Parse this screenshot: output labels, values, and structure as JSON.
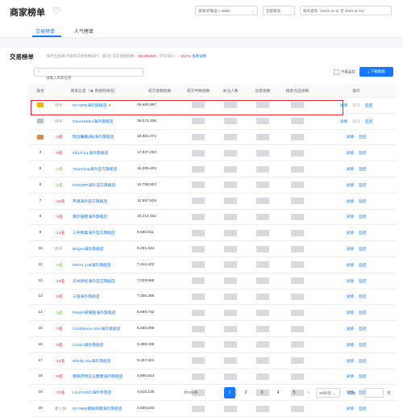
{
  "header": {
    "title": "商家榜单",
    "filter_industry": "美妆/护肤品 > NMN",
    "filter_channel": "全部渠道",
    "filter_date": "按天查询（2024-11-11 至 2024-11-11）"
  },
  "tabs": [
    {
      "label": "交易榜单"
    },
    {
      "label": "人气榜单"
    }
  ],
  "section": {
    "title": "交易榜单",
    "desc_prefix": "按行业类目/子类目交易指数排行，第1名 成交金额指数：",
    "desc_value": "49,680,967",
    "desc_mid": "，环比增长：",
    "desc_growth": "↑ 10.2%",
    "desc_link": "查看详情"
  },
  "search": {
    "placeholder": "请输入商家名称"
  },
  "only_watched": "只看监控",
  "download_label": "下载数据",
  "columns": [
    "排名",
    "商家信息（★ 则规则排名）",
    "成交金额指数",
    "成交件数指数",
    "关注人数",
    "访客指数",
    "搜索点击指数",
    "操作"
  ],
  "rows": [
    {
      "rank": "1",
      "change": "持平",
      "dir": "flat",
      "shop": "W+NMN海外旗舰店",
      "sales": "49,680,967",
      "medal": "gold",
      "star": true
    },
    {
      "rank": "2",
      "change": "持平",
      "dir": "flat",
      "shop": "GeneHarbor海外旗舰店",
      "sales": "36,071,306",
      "medal": "silver"
    },
    {
      "rank": "3",
      "change": "↑3名",
      "dir": "up",
      "shop": "明治醫藥(株)海外旗舰店",
      "sales": "18,861,072",
      "medal": "bronze"
    },
    {
      "rank": "4",
      "change": "↑8名",
      "dir": "up",
      "shop": "CELFLLL海外旗舰店",
      "sales": "17,937,253"
    },
    {
      "rank": "5",
      "change": "↓1名",
      "dir": "down",
      "shop": "TimeShop海外官方旗舰店",
      "sales": "16,205,203"
    },
    {
      "rank": "6",
      "change": "↓1名",
      "dir": "down",
      "shop": "PSSOPP海外官方旗舰店",
      "sales": "10,758,524"
    },
    {
      "rank": "7",
      "change": "↑23名",
      "dir": "up",
      "shop": "燕语海外官方旗舰店",
      "sales": "10,557,529"
    },
    {
      "rank": "8",
      "change": "↑3名",
      "dir": "up",
      "shop": "莱印维健海外旗舰店",
      "sales": "10,214,451"
    },
    {
      "rank": "9",
      "change": "↑14名",
      "dir": "up",
      "shop": "三井製菓海外官方旗舰店",
      "sales": "9,580,611"
    },
    {
      "rank": "10",
      "change": "持平",
      "dir": "flat",
      "shop": "Bioges海外旗舰店",
      "sales": "9,261,543"
    },
    {
      "rank": "11",
      "change": "↓3名",
      "dir": "down",
      "shop": "MIRAI LAB海外旗舰店",
      "sales": "7,244,422"
    },
    {
      "rank": "12",
      "change": "↑19名",
      "dir": "up",
      "shop": "日本新松海外官方旗舰店",
      "sales": "7,028,896"
    },
    {
      "rank": "13",
      "change": "↑9名",
      "dir": "up",
      "shop": "三道海外旗舰店",
      "sales": "7,006,356"
    },
    {
      "rank": "14",
      "change": "↓3名",
      "dir": "down",
      "shop": "FMUKI荣耀医海外旗舰店",
      "sales": "5,689,732"
    },
    {
      "rank": "15",
      "change": "↑7名",
      "dir": "up",
      "shop": "Confidence USA海外旗舰店",
      "sales": "5,466,009"
    },
    {
      "rank": "16",
      "change": "↑6名",
      "dir": "up",
      "shop": "CAIYU海外旗舰店",
      "sales": "5,368,338"
    },
    {
      "rank": "17",
      "change": "↑12名",
      "dir": "up",
      "shop": "Wholly You海外旗舰店",
      "sales": "5,187,921"
    },
    {
      "rank": "18",
      "change": "↑9名",
      "dir": "up",
      "shop": "康研药物实业健康海外旗舰店",
      "sales": "4,650,614"
    },
    {
      "rank": "19",
      "change": "↑31名",
      "dir": "up",
      "shop": "LIUZHANG海外专营店",
      "sales": "4,616,125"
    },
    {
      "rank": "20",
      "change": "新入榜",
      "dir": "new",
      "shop": "W+NMN美肤保健海外旗舰店",
      "sales": "4,550,533"
    }
  ],
  "ops": {
    "detail": "详情",
    "cancel": "取消",
    "monitor": "监控"
  },
  "pagination": {
    "total": "共100条",
    "pages": [
      "1",
      "2",
      "3",
      "4",
      "5"
    ],
    "next": "›",
    "prev": "‹",
    "page_size": "20条/页",
    "jump": "前往",
    "jump_suffix": "页"
  }
}
